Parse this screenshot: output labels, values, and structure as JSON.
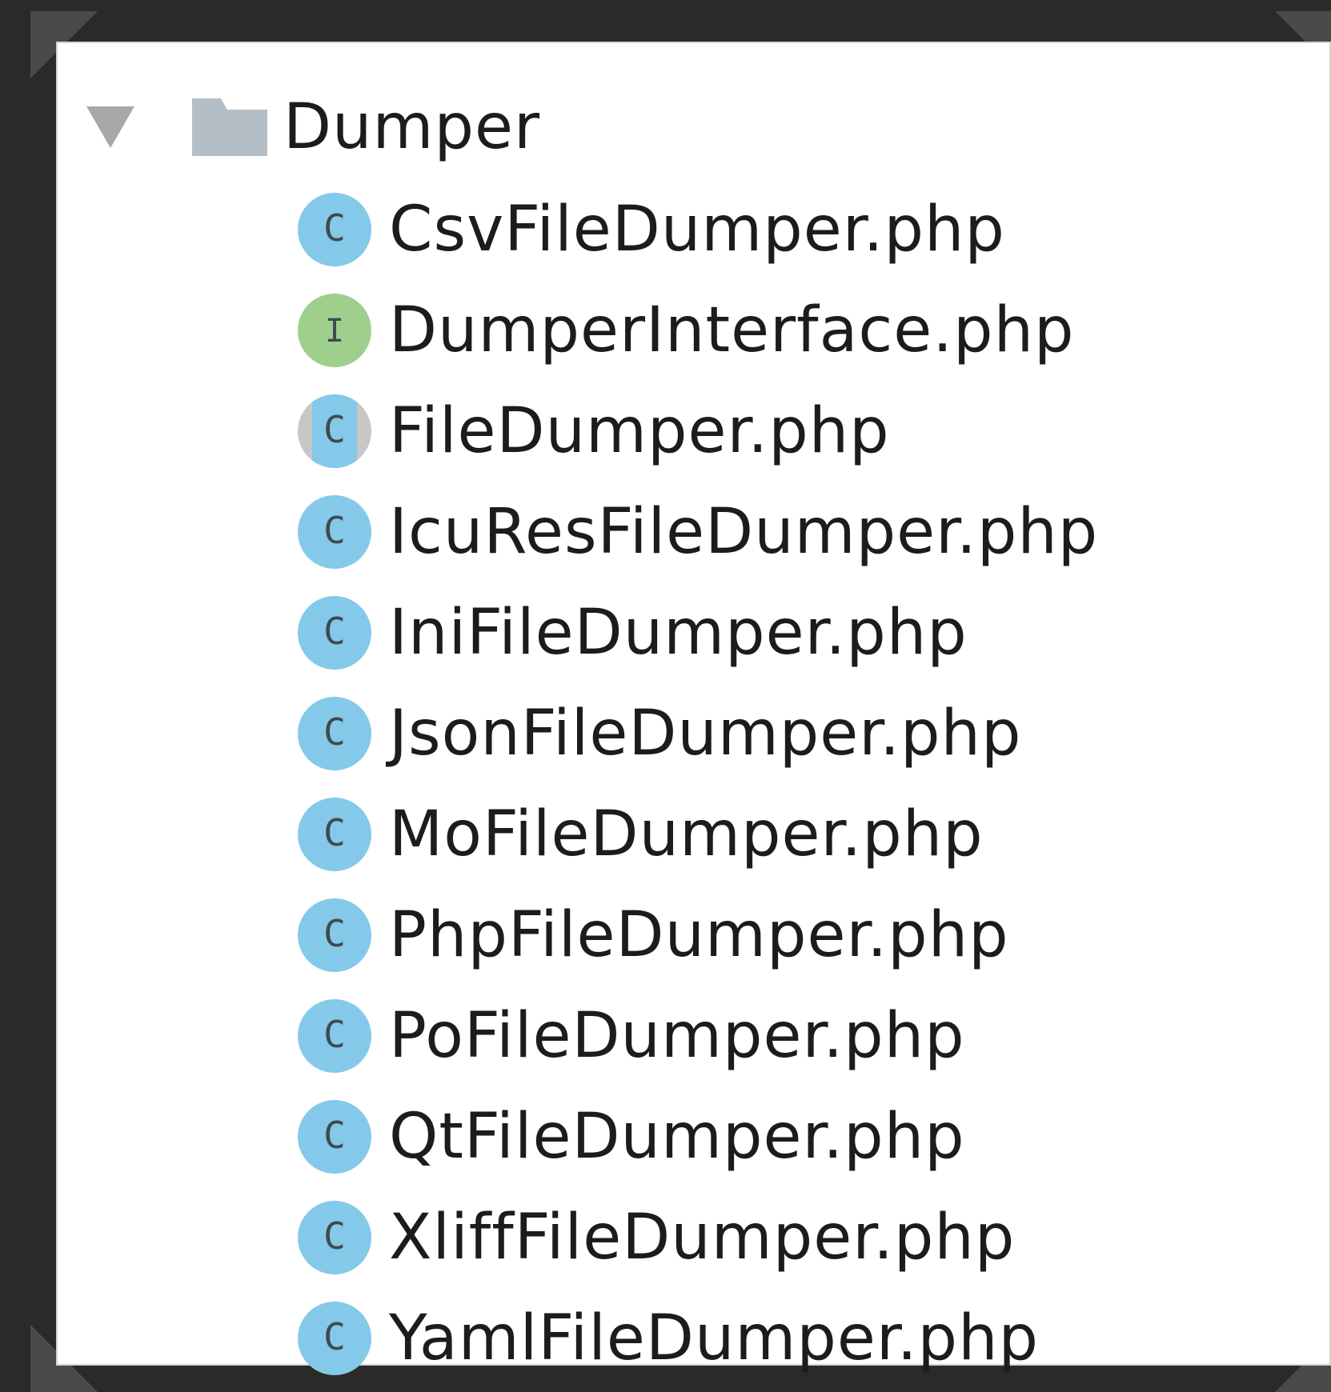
{
  "tree": {
    "folder": {
      "label": "Dumper",
      "icon": "folder-icon",
      "expanded": true
    },
    "files": [
      {
        "label": "CsvFileDumper.php",
        "kind": "class",
        "glyph": "C"
      },
      {
        "label": "DumperInterface.php",
        "kind": "interface",
        "glyph": "I"
      },
      {
        "label": "FileDumper.php",
        "kind": "abstract-class",
        "glyph": "C"
      },
      {
        "label": "IcuResFileDumper.php",
        "kind": "class",
        "glyph": "C"
      },
      {
        "label": "IniFileDumper.php",
        "kind": "class",
        "glyph": "C"
      },
      {
        "label": "JsonFileDumper.php",
        "kind": "class",
        "glyph": "C"
      },
      {
        "label": "MoFileDumper.php",
        "kind": "class",
        "glyph": "C"
      },
      {
        "label": "PhpFileDumper.php",
        "kind": "class",
        "glyph": "C"
      },
      {
        "label": "PoFileDumper.php",
        "kind": "class",
        "glyph": "C"
      },
      {
        "label": "QtFileDumper.php",
        "kind": "class",
        "glyph": "C"
      },
      {
        "label": "XliffFileDumper.php",
        "kind": "class",
        "glyph": "C"
      },
      {
        "label": "YamlFileDumper.php",
        "kind": "class",
        "glyph": "C"
      }
    ]
  },
  "colors": {
    "class_icon": "#84c9e9",
    "interface_icon": "#9fcf8c",
    "abstract_side": "#c7c7c7",
    "folder": "#b4bec6",
    "glyph": "#3f4a50"
  }
}
